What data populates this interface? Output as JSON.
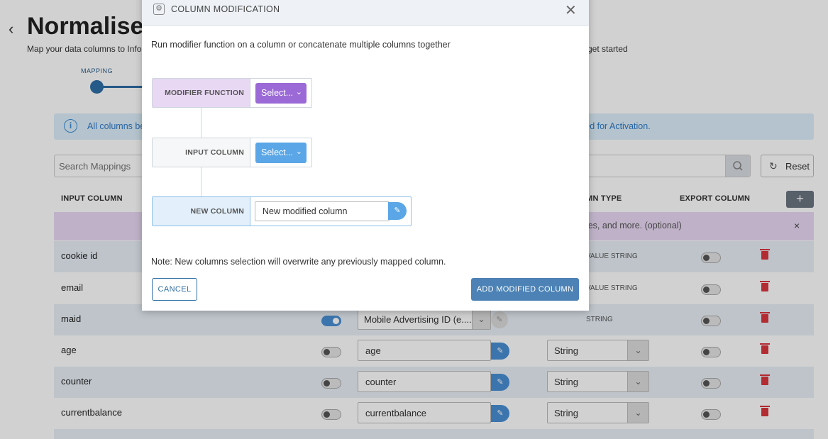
{
  "page": {
    "title": "Normalise:",
    "subtitle_left": "Map your data columns to Info",
    "subtitle_right": "u get started",
    "back_icon": "chevron-left-icon"
  },
  "stepper": {
    "step1_label": "MAPPING"
  },
  "info_banner": {
    "text_left": "All columns be",
    "text_right": "sed for Activation."
  },
  "search": {
    "placeholder": "Search Mappings"
  },
  "reset_button": {
    "label": "Reset"
  },
  "table": {
    "headers": {
      "input_column": "INPUT COLUMN",
      "column_type": "UMN TYPE",
      "export_column": "EXPORT COLUMN"
    },
    "add_button": "+",
    "promo_text": "lues, and more. (optional)",
    "promo_close": "×",
    "rows": [
      {
        "name": "cookie id",
        "type_text": "VALUE STRING"
      },
      {
        "name": "email",
        "type_text": "VALUE STRING"
      },
      {
        "name": "maid",
        "mapped": "Mobile Advertising ID (e....",
        "type_text": "STRING"
      },
      {
        "name": "age",
        "mapped": "age",
        "type": "String"
      },
      {
        "name": "counter",
        "mapped": "counter",
        "type": "String"
      },
      {
        "name": "currentbalance",
        "mapped": "currentbalance",
        "type": "String"
      }
    ]
  },
  "modal": {
    "title": "COLUMN MODIFICATION",
    "description": "Run modifier function on a column or concatenate multiple columns together",
    "modifier_function_label": "MODIFIER FUNCTION",
    "modifier_select": "Select...",
    "input_column_label": "INPUT COLUMN",
    "input_select": "Select...",
    "new_column_label": "NEW COLUMN",
    "new_column_value": "New modified column",
    "note": "Note: New columns selection will overwrite any previously mapped column.",
    "cancel_label": "CANCEL",
    "add_label": "ADD MODIFIED COLUMN"
  },
  "colors": {
    "accent": "#4c82b5",
    "purple": "#9b6ad6",
    "blue": "#5aa6e6",
    "danger": "#d9363e"
  }
}
